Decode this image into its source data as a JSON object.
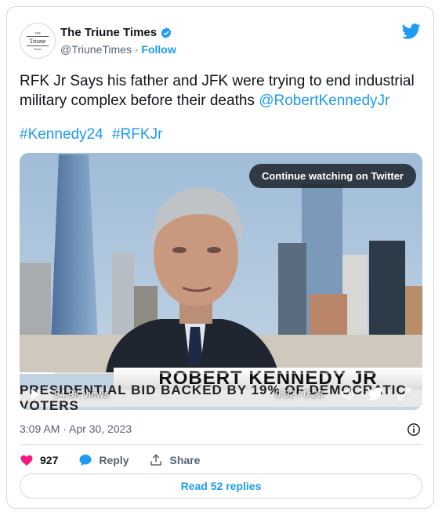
{
  "account": {
    "display_name": "The Triune Times",
    "handle": "@TriuneTimes",
    "separator": " · ",
    "follow_label": "Follow",
    "avatar_logo_text": "Triune",
    "avatar_logo_small": "THE",
    "avatar_logo_small_bottom": "Times",
    "verified": true
  },
  "tweet": {
    "text": "RFK Jr Says his father and JFK were trying to end industrial military complex before their deaths ",
    "mention": "@RobertKennedyJr",
    "hashtags": [
      "#Kennedy24",
      "#RFKJr"
    ]
  },
  "media": {
    "continue_label": "Continue watching on Twitter",
    "lower_third_name": "ROBERT KENNEDY JR",
    "lower_third_sub": "PRESIDENTIAL BID BACKED BY 19% OF DEMOCRATIC VOTERS",
    "views": "54.9K views",
    "time": "0:02 / 0:23",
    "progress_fraction": 0.087
  },
  "meta": {
    "timestamp": "3:09 AM · Apr 30, 2023"
  },
  "actions": {
    "like_count": "927",
    "reply_label": "Reply",
    "share_label": "Share",
    "read_replies_label": "Read 52 replies"
  },
  "colors": {
    "accent": "#1d9bf0",
    "like": "#f91880",
    "muted": "#536471"
  },
  "icons": [
    "verified-badge-icon",
    "twitter-bird-icon",
    "play-icon",
    "volume-icon",
    "fullscreen-icon",
    "info-icon",
    "heart-icon",
    "reply-bubble-icon",
    "share-icon"
  ]
}
